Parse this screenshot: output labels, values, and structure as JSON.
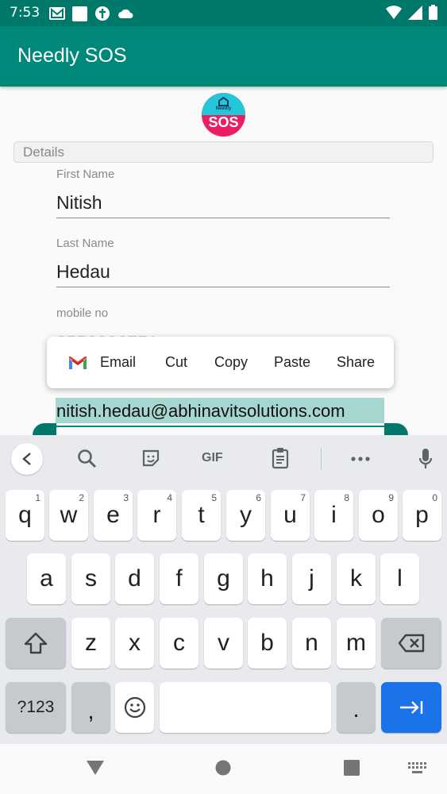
{
  "status_bar": {
    "time": "7:53",
    "left_icons": [
      "gmail-icon",
      "square-icon",
      "circle-icon",
      "cloud-icon"
    ],
    "right_icons": [
      "wifi-icon",
      "signal-icon",
      "battery-icon"
    ]
  },
  "app_bar": {
    "title": "Needly SOS"
  },
  "logo": {
    "brand": "Needly",
    "text": "SOS"
  },
  "details": {
    "section_label": "Details",
    "first_name": {
      "label": "First Name",
      "value": "Nitish"
    },
    "last_name": {
      "label": "Last Name",
      "value": "Hedau"
    },
    "mobile": {
      "label": "mobile no",
      "value": "8552393771"
    },
    "email": {
      "value": "nitish.hedau@abhinavitsolutions.com"
    }
  },
  "context_menu": {
    "items": [
      "Email",
      "Cut",
      "Copy",
      "Paste",
      "Share"
    ]
  },
  "keyboard": {
    "toolbar_icons": [
      "back-icon",
      "search-icon",
      "sticker-icon",
      "gif-icon",
      "clipboard-icon",
      "more-icon",
      "mic-icon"
    ],
    "gif_label": "GIF",
    "row1": [
      {
        "k": "q",
        "h": "1"
      },
      {
        "k": "w",
        "h": "2"
      },
      {
        "k": "e",
        "h": "3"
      },
      {
        "k": "r",
        "h": "4"
      },
      {
        "k": "t",
        "h": "5"
      },
      {
        "k": "y",
        "h": "6"
      },
      {
        "k": "u",
        "h": "7"
      },
      {
        "k": "i",
        "h": "8"
      },
      {
        "k": "o",
        "h": "9"
      },
      {
        "k": "p",
        "h": "0"
      }
    ],
    "row2": [
      "a",
      "s",
      "d",
      "f",
      "g",
      "h",
      "j",
      "k",
      "l"
    ],
    "row3": [
      "z",
      "x",
      "c",
      "v",
      "b",
      "n",
      "m"
    ],
    "symbols_label": "?123",
    "comma": ",",
    "period": "."
  },
  "colors": {
    "status_bar": "#00796b",
    "app_bar": "#00897b",
    "selection": "#a5d6cf",
    "keyboard_bg": "#e8eaed",
    "enter_key": "#1a73e8"
  }
}
